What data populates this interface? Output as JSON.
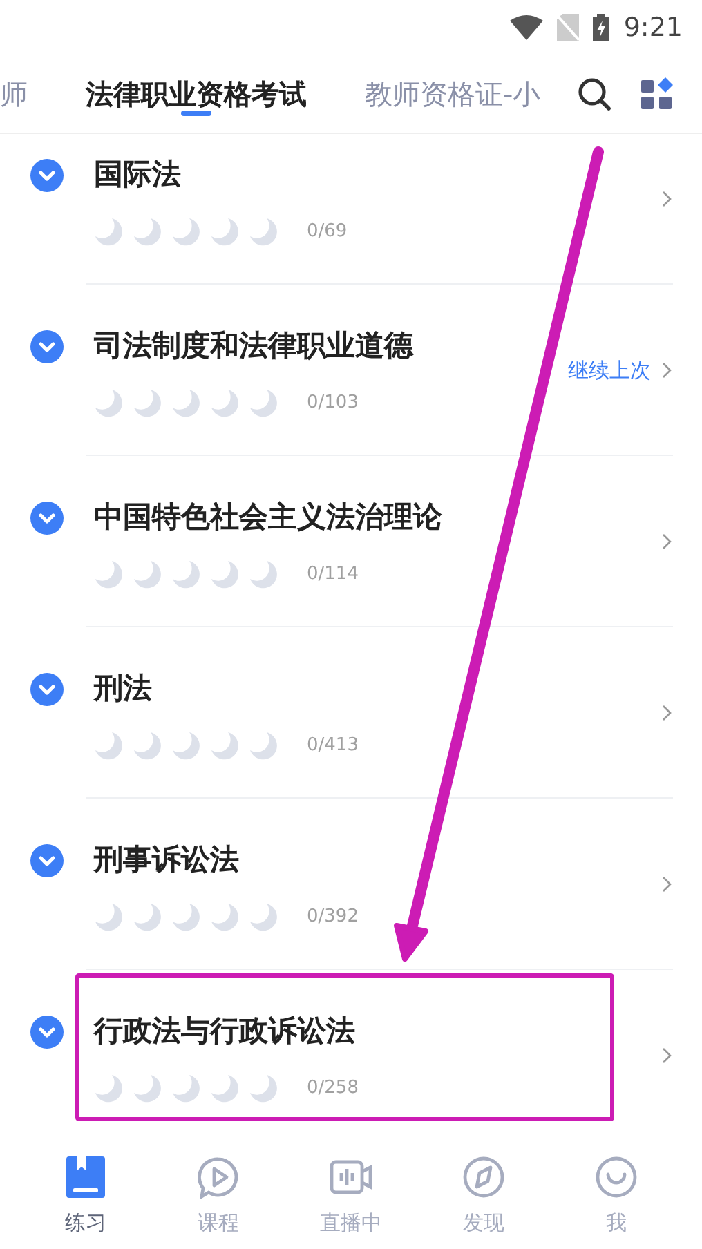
{
  "status_bar": {
    "time": "9:21"
  },
  "tabs": [
    {
      "label": "师",
      "selected": false
    },
    {
      "label": "法律职业资格考试",
      "selected": true
    },
    {
      "label": "教师资格证-小",
      "selected": false
    }
  ],
  "chapters": [
    {
      "title": "国际法",
      "stars": 0,
      "count": "0/69",
      "highlighted": false
    },
    {
      "title": "司法制度和法律职业道德",
      "stars": 0,
      "count": "0/103",
      "resume": "继续上次",
      "highlighted": false
    },
    {
      "title": "中国特色社会主义法治理论",
      "stars": 0,
      "count": "0/114",
      "highlighted": false
    },
    {
      "title": "刑法",
      "stars": 0,
      "count": "0/413",
      "highlighted": false
    },
    {
      "title": "刑事诉讼法",
      "stars": 0,
      "count": "0/392",
      "highlighted": false
    },
    {
      "title": "行政法与行政诉讼法",
      "stars": 0,
      "count": "0/258",
      "highlighted": true
    }
  ],
  "bottom_nav": [
    {
      "label": "练习",
      "kind": "book",
      "selected": true
    },
    {
      "label": "课程",
      "kind": "play",
      "selected": false
    },
    {
      "label": "直播中",
      "kind": "live",
      "selected": false
    },
    {
      "label": "发现",
      "kind": "compass",
      "selected": false
    },
    {
      "label": "我",
      "kind": "smile",
      "selected": false
    }
  ]
}
